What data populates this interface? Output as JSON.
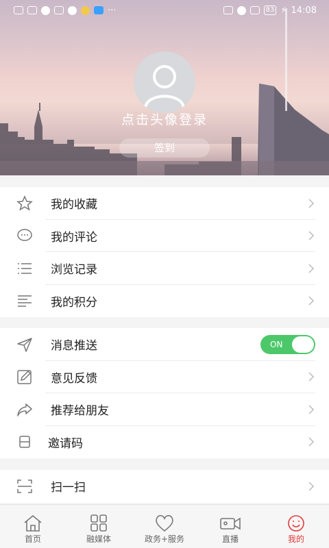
{
  "status_bar": {
    "left_glyph": "···",
    "battery": "83",
    "time": "14:08"
  },
  "profile": {
    "login_prompt": "点击头像登录",
    "checkin_label": "签到"
  },
  "menu_group_1": [
    {
      "label": "我的收藏",
      "icon": "star-icon"
    },
    {
      "label": "我的评论",
      "icon": "comment-icon"
    },
    {
      "label": "浏览记录",
      "icon": "list-icon"
    },
    {
      "label": "我的积分",
      "icon": "points-icon"
    }
  ],
  "menu_group_2": [
    {
      "label": "消息推送",
      "icon": "send-icon",
      "toggle": "ON"
    },
    {
      "label": "意见反馈",
      "icon": "edit-icon"
    },
    {
      "label": "推荐给朋友",
      "icon": "share-icon"
    },
    {
      "label": "邀请码",
      "icon": "invite-icon"
    }
  ],
  "menu_group_3": [
    {
      "label": "扫一扫",
      "icon": "scan-icon"
    }
  ],
  "tabbar": [
    {
      "label": "首页",
      "icon": "home-icon"
    },
    {
      "label": "融媒体",
      "icon": "grid-icon"
    },
    {
      "label": "政务+服务",
      "icon": "heart-icon"
    },
    {
      "label": "直播",
      "icon": "camera-icon"
    },
    {
      "label": "我的",
      "icon": "smile-icon",
      "active": true
    }
  ],
  "colors": {
    "accent_red": "#e23a3a",
    "toggle_green": "#4cc86a"
  }
}
